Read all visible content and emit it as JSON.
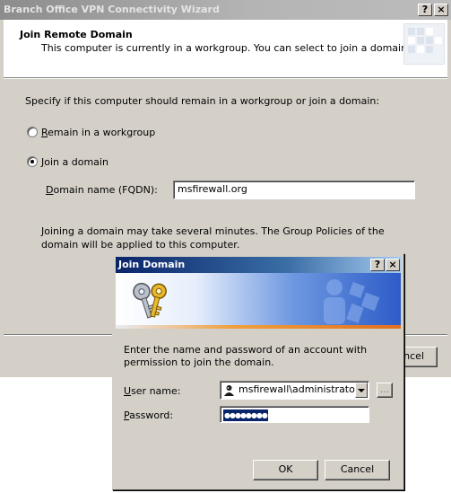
{
  "wizard": {
    "title": "Branch Office VPN Connectivity Wizard",
    "help_label": "?",
    "close_label": "×",
    "header_title": "Join Remote Domain",
    "header_subtitle": "This computer is currently in a workgroup. You can select to join a domain.",
    "prompt": "Specify if this computer should remain in a workgroup or join a domain:",
    "options": [
      {
        "label": "Remain in a workgroup",
        "mnemonic": "R",
        "rest": "emain in a workgroup",
        "selected": false
      },
      {
        "label": "Join a domain",
        "mnemonic": "J",
        "rest": "oin a domain",
        "selected": true
      }
    ],
    "domain_label_mnemonic": "D",
    "domain_label_rest": "omain name (FQDN):",
    "domain_value": "msfirewall.org",
    "note": "Joining a domain may take several minutes. The Group Policies of the domain will be applied to this computer.",
    "cancel_partial": "ncel"
  },
  "dialog": {
    "title": "Join Domain",
    "help_label": "?",
    "close_label": "×",
    "description": "Enter the name and password of an account with permission to join the domain.",
    "user_label_mnemonic": "U",
    "user_label_rest": "ser name:",
    "user_value": "msfirewall\\administrator",
    "password_label_mnemonic": "P",
    "password_label_rest": "assword:",
    "password_mask": "●●●●●●●●",
    "browse_label": "...",
    "ok_label": "OK",
    "cancel_label": "Cancel"
  },
  "colors": {
    "dialog_titlebar": "#0a246a",
    "wizard_titlebar_inactive": "#8c8c8c",
    "face": "#d4d0c8",
    "selection": "#0a246a"
  },
  "icons": [
    "keys-icon",
    "user-icon",
    "dropdown-arrow-icon",
    "banner-logo-icon"
  ]
}
